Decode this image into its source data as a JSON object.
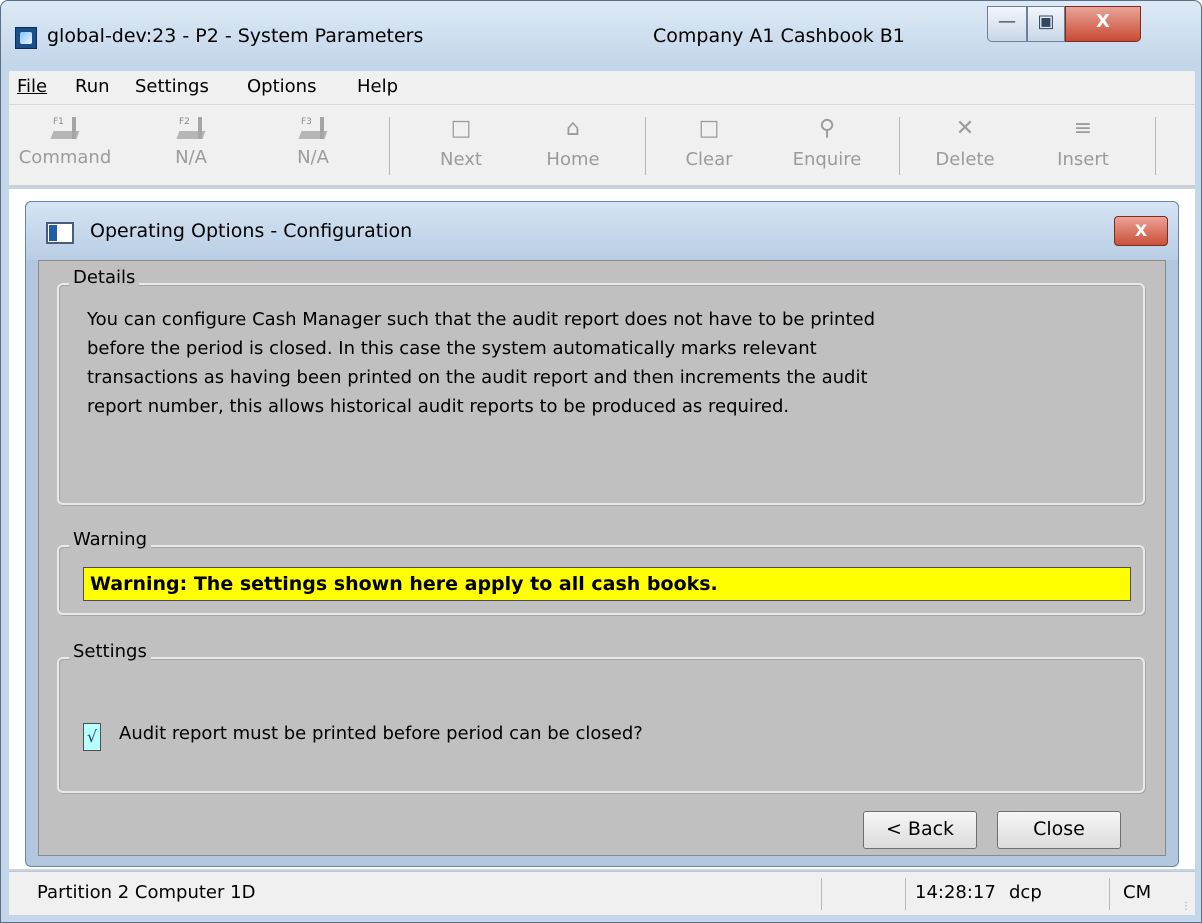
{
  "window": {
    "title": "global-dev:23 - P2 - System Parameters",
    "company_info": "Company A1  Cashbook B1",
    "minimize_glyph": "—",
    "maximize_glyph": "▣",
    "close_glyph": "X"
  },
  "menu": {
    "items": [
      {
        "label": "File",
        "accel": "F"
      },
      {
        "label": "Run",
        "accel": "R"
      },
      {
        "label": "Settings",
        "accel": "S"
      },
      {
        "label": "Options",
        "accel": "O"
      },
      {
        "label": "Help",
        "accel": "H"
      }
    ]
  },
  "toolbar": {
    "items": [
      {
        "label": "Command",
        "icon": "f1-key-icon",
        "key": "F1"
      },
      {
        "label": "N/A",
        "icon": "f2-key-icon",
        "key": "F2"
      },
      {
        "label": "N/A",
        "icon": "f3-key-icon",
        "key": "F3"
      },
      {
        "label": "Next",
        "icon": "page-icon"
      },
      {
        "label": "Home",
        "icon": "home-icon"
      },
      {
        "label": "Clear",
        "icon": "clear-icon"
      },
      {
        "label": "Enquire",
        "icon": "magnifier-icon"
      },
      {
        "label": "Delete",
        "icon": "delete-x-icon"
      },
      {
        "label": "Insert",
        "icon": "insert-row-icon"
      }
    ]
  },
  "dialog": {
    "title": "Operating Options - Configuration",
    "close_glyph": "X",
    "details": {
      "legend": "Details",
      "text": "You can configure Cash Manager such that the audit report does not have to be printed before the period is closed. In this case the system automatically marks relevant transactions as having been printed on the audit report and then increments the audit report number, this allows historical audit reports to be produced as required."
    },
    "warning": {
      "legend": "Warning",
      "text": "Warning: The settings shown here apply to all cash books.",
      "color": "#ffff00"
    },
    "settings": {
      "legend": "Settings",
      "checkbox_label": "Audit report must be printed before period can be closed?",
      "checked": true,
      "check_glyph": "√"
    },
    "buttons": {
      "back": "< Back",
      "close": "Close"
    }
  },
  "status": {
    "partition": "Partition 2 Computer 1D",
    "time": "14:28:17",
    "user": "dcp",
    "module": "CM"
  }
}
